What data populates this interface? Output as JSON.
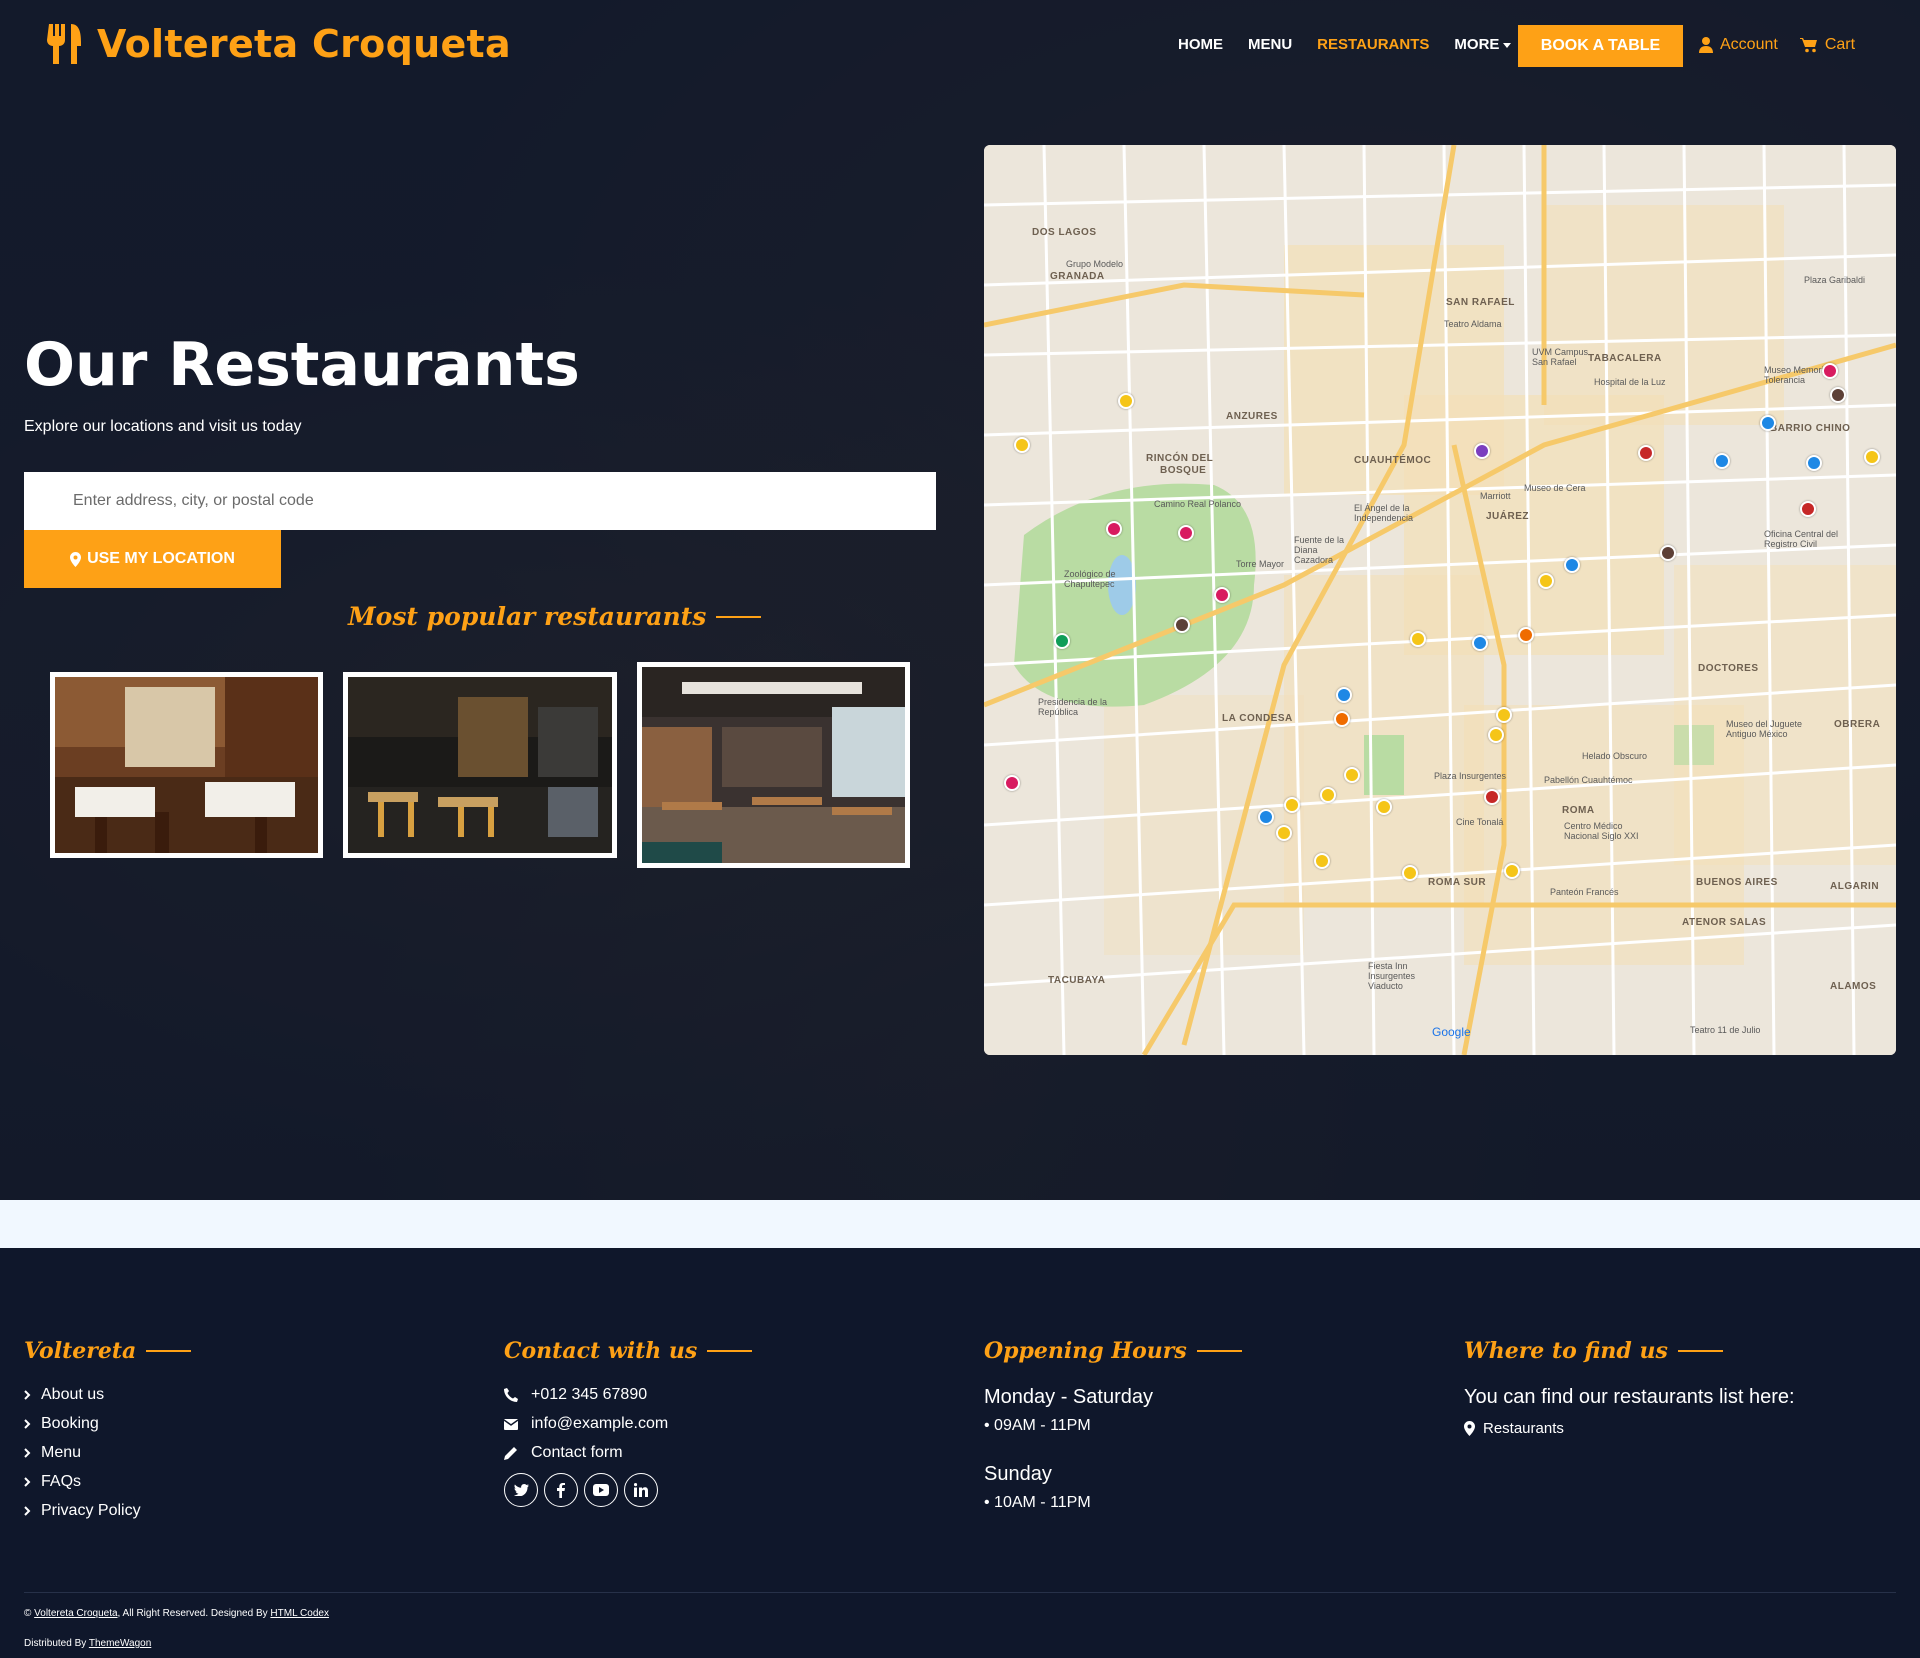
{
  "brand": {
    "name": "Voltereta Croqueta"
  },
  "nav": {
    "links": [
      "HOME",
      "MENU",
      "RESTAURANTS",
      "MORE"
    ],
    "book": "BOOK A TABLE",
    "account": "Account",
    "cart": "Cart",
    "accent": "#fea116"
  },
  "hero": {
    "title": "Our Restaurants",
    "subtitle": "Explore our locations and visit us today",
    "search_placeholder": "Enter address, city, or postal code",
    "location_button": "USE MY LOCATION",
    "popular": "Most popular restaurants"
  },
  "map": {
    "labels": {
      "dos_lagos": "DOS LAGOS",
      "granada": "GRANADA",
      "anzures": "ANZURES",
      "rincon": "RINCÓN DEL",
      "bosque": "BOSQUE",
      "cuauhtemoc": "CUAUHTÉMOC",
      "juarez": "JUÁREZ",
      "san_rafael": "SAN RAFAEL",
      "tabacalera": "TABACALERA",
      "barrio_chino": "BARRIO CHINO",
      "la_condesa": "LA CONDESA",
      "roma": "ROMA",
      "roma_sur": "ROMA SUR",
      "doctores": "DOCTORES",
      "obrera": "OBRERA",
      "buenos_aires": "BUENOS AIRES",
      "algarin": "ALGARIN",
      "atenor_salas": "ATENOR SALAS",
      "alamos": "ALAMOS",
      "tacubaya": "TACUBAYA",
      "chapultepec": "Zoológico de Chapultepec",
      "camino_real": "Camino Real Polanco",
      "angel": "El Ángel de la Independencia",
      "diana": "Fuente de la Diana Cazadora",
      "torre": "Torre Mayor",
      "presidencia": "Presidencia de la República",
      "museo_cera": "Museo de Cera",
      "marriott": "Marriott",
      "teatro": "Teatro Aldama",
      "uvm": "UVM Campus San Rafael",
      "hospital_luz": "Hospital de la Luz",
      "museo_memoria": "Museo Memoria y Tolerancia",
      "oficina": "Oficina Central del Registro Civil",
      "plaza_garibaldi": "Plaza Garibaldi",
      "plaza_insurgentes": "Plaza Insurgentes",
      "pabellon": "Pabellón Cuauhtémoc",
      "centro_medico": "Centro Médico Nacional Siglo XXI",
      "museo_juguete": "Museo del Juguete Antiguo México",
      "cine": "Cine Tonalá",
      "panteon": "Panteón Francés",
      "helado": "Helado Obscuro",
      "fiesta_inn": "Fiesta Inn Insurgentes Viaducto",
      "teatro_julio": "Teatro 11 de Julio",
      "grupo_modelo": "Grupo Modelo",
      "google": "Google"
    }
  },
  "footer": {
    "col1": {
      "title": "Voltereta",
      "items": [
        "About us",
        "Booking",
        "Menu",
        "FAQs",
        "Privacy Policy"
      ]
    },
    "col2": {
      "title": "Contact with us",
      "phone": "+012 345 67890",
      "email": "info@example.com",
      "form": "Contact form"
    },
    "col3": {
      "title": "Oppening Hours",
      "day1": "Monday - Saturday",
      "time1": "• 09AM - 11PM",
      "day2": "Sunday",
      "time2": "• 10AM - 11PM"
    },
    "col4": {
      "title": "Where to find us",
      "text": "You can find our restaurants list here:",
      "link": "Restaurants"
    },
    "copyright": {
      "prefix": "©",
      "brand": "Voltereta Croqueta",
      "mid": ", All Right Reserved. Designed By",
      "designer": "HTML Codex",
      "dist": "Distributed By",
      "distributor": "ThemeWagon"
    }
  }
}
